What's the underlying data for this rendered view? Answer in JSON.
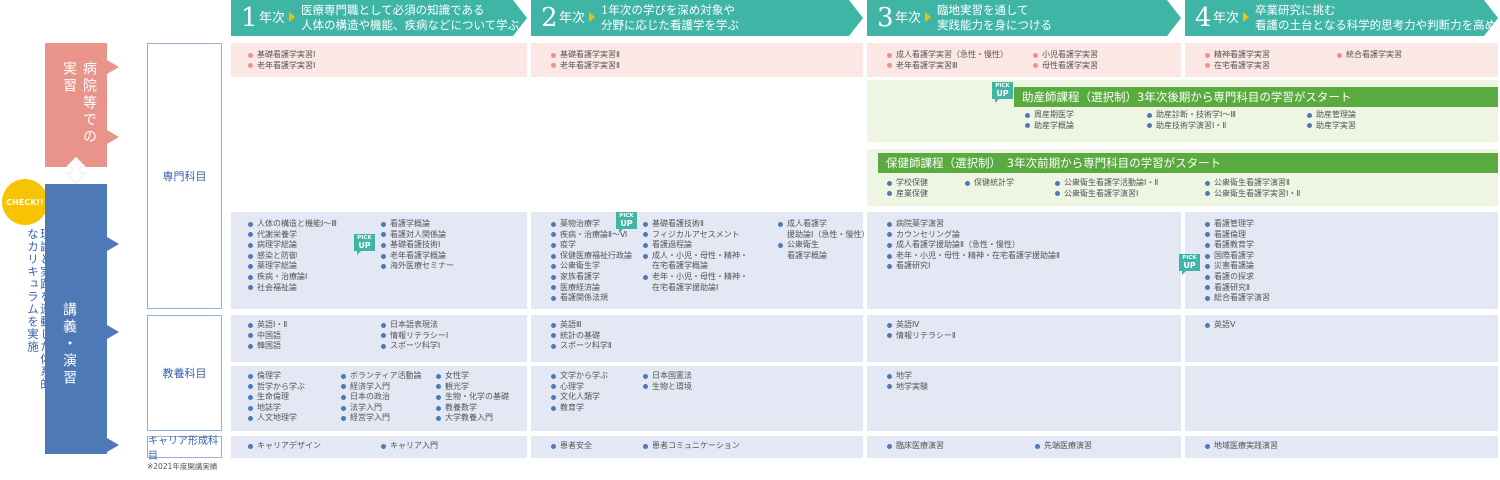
{
  "years": [
    {
      "num": "1",
      "label": "年次",
      "title": [
        "医療専門職として必須の知識である",
        "人体の構造や機能、疾病などについて学ぶ"
      ]
    },
    {
      "num": "2",
      "label": "年次",
      "title": [
        "1年次の学びを深め対象や",
        "分野に応じた看護学を学ぶ"
      ]
    },
    {
      "num": "3",
      "label": "年次",
      "title": [
        "臨地実習を通して",
        "実践能力を身につける"
      ]
    },
    {
      "num": "4",
      "label": "年次",
      "title": [
        "卒業研究に挑む",
        "看護の土台となる科学的思考力や判断力を高める"
      ]
    }
  ],
  "left": {
    "practice_label": "病院等での実習",
    "lecture_label": "講義・演習",
    "check_label": "CHECK!!",
    "side_text": "理論と実践を連動した体系的なカリキュラムを実施"
  },
  "categories": {
    "senmon": "専門科目",
    "kyoyo": "教養科目",
    "career": "キャリア形成科目"
  },
  "pick": {
    "line1": "PICK",
    "line2": "UP"
  },
  "practice": {
    "y1": [
      "基礎看護学実習Ⅰ",
      "老年看護学実習Ⅰ"
    ],
    "y2": [
      "基礎看護学実習Ⅱ",
      "老年看護学実習Ⅱ"
    ],
    "y3a": [
      "成人看護学実習（急性・慢性）",
      "老年看護学実習Ⅲ"
    ],
    "y3b": [
      "小児看護学実習",
      "母性看護学実習"
    ],
    "y4a": [
      "精神看護学実習",
      "在宅看護学実習"
    ],
    "y4b": [
      "統合看護学実習"
    ]
  },
  "josanshi": {
    "title": "助産師課程（選択制）3年次後期から専門科目の学習がスタート",
    "col1": [
      "周産期医学",
      "助産学概論"
    ],
    "col2": [
      "助産診断・技術学Ⅰ～Ⅲ",
      "助産技術学演習Ⅰ・Ⅱ"
    ],
    "col3": [
      "助産管理論",
      "助産学実習"
    ]
  },
  "hokenshi": {
    "title": "保健師課程（選択制）　3年次前期から専門科目の学習がスタート",
    "col1": [
      "学校保健",
      "産業保健"
    ],
    "col2": [
      "保健統計学"
    ],
    "col3": [
      "公衆衛生看護学活動論Ⅰ・Ⅱ",
      "公衆衛生看護学演習Ⅰ"
    ],
    "col4": [
      "公衆衛生看護学演習Ⅱ",
      "公衆衛生看護学実習Ⅰ・Ⅱ"
    ]
  },
  "senmon": {
    "y1a": [
      "人体の構造と機能Ⅰ～Ⅲ",
      "代謝栄養学",
      "病理学総論",
      "感染と防御",
      "薬理学総論",
      "疾病・治療論Ⅰ",
      "社会福祉論"
    ],
    "y1b": [
      "看護学概論",
      "看護対人関係論",
      "基礎看護技術Ⅰ",
      "老年看護学概論",
      "海外医療セミナー"
    ],
    "y2a": [
      "薬物治療学",
      "疾病・治療論Ⅱ～Ⅵ",
      "疫学",
      "保健医療福祉行政論",
      "公衆衛生学",
      "家族看護学",
      "医療経済論",
      "看護関係法規"
    ],
    "y2b": [
      "基礎看護技術Ⅱ",
      "フィジカルアセスメント",
      "看護過程論",
      "成人・小児・母性・精神・",
      "在宅看護学概論",
      "老年・小児・母性・精神・",
      "在宅看護学援助論Ⅰ"
    ],
    "y2c": [
      "成人看護学",
      "援助論Ⅰ（急性・慢性）",
      "公衆衛生",
      "看護学概論"
    ],
    "y3": [
      "病院薬学演習",
      "カウンセリング論",
      "成人看護学援助論Ⅱ（急性・慢性）",
      "老年・小児・母性・精神・在宅看護学援助論Ⅱ",
      "看護研究Ⅰ"
    ],
    "y4": [
      "看護管理学",
      "看護倫理",
      "看護教育学",
      "国際看護学",
      "災害看護論",
      "看護の探求",
      "看護研究Ⅱ",
      "総合看護学演習"
    ]
  },
  "kyoyo_lang": {
    "y1a": [
      "英語Ⅰ・Ⅱ",
      "中国語",
      "韓国語"
    ],
    "y1b": [
      "日本語表現法",
      "情報リテラシーⅠ",
      "スポーツ科学Ⅰ"
    ],
    "y2": [
      "英語Ⅲ",
      "統計の基礎",
      "スポーツ科学Ⅱ"
    ],
    "y3": [
      "英語Ⅳ",
      "情報リテラシーⅡ"
    ],
    "y4": [
      "英語Ⅴ"
    ]
  },
  "kyoyo_gen": {
    "y1a": [
      "倫理学",
      "哲学から学ぶ",
      "生命倫理",
      "地誌学",
      "人文地理学"
    ],
    "y1b": [
      "ボランティア活動論",
      "経済学入門",
      "日本の政治",
      "法学入門",
      "経営学入門"
    ],
    "y1c": [
      "女性学",
      "観光学",
      "生物・化学の基礎",
      "教養数学",
      "大学教養入門"
    ],
    "y2a": [
      "文学から学ぶ",
      "心理学",
      "文化人類学",
      "教育学"
    ],
    "y2b": [
      "日本国憲法",
      "生物と環境"
    ],
    "y3": [
      "地学",
      "地学実験"
    ]
  },
  "career": {
    "y1a": [
      "キャリアデザイン"
    ],
    "y1b": [
      "キャリア入門"
    ],
    "y2a": [
      "患者安全"
    ],
    "y2b": [
      "患者コミュニケーション"
    ],
    "y3a": [
      "臨床医療演習"
    ],
    "y3b": [
      "先端医療演習"
    ],
    "y4": [
      "地域医療実践演習"
    ]
  },
  "note": "※2021年度開講実績"
}
